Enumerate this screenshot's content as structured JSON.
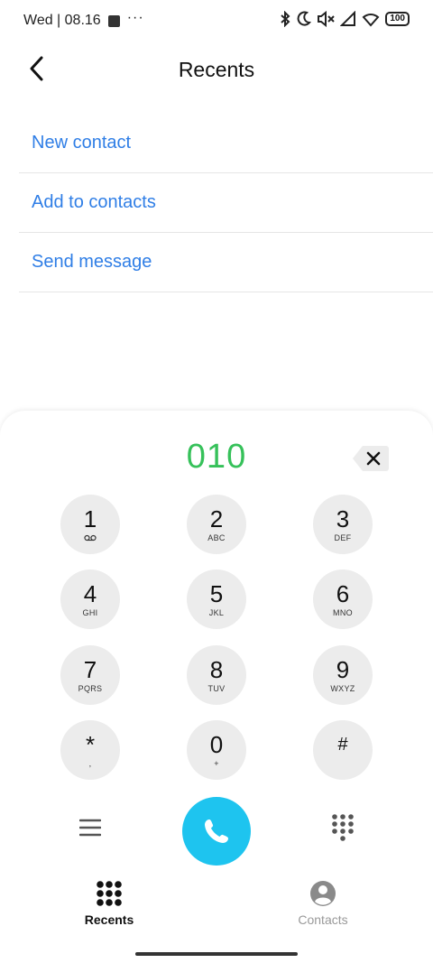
{
  "status_bar": {
    "time": "Wed | 08.16",
    "more": "···",
    "battery": "100"
  },
  "header": {
    "title": "Recents"
  },
  "actions": [
    {
      "label": "New contact"
    },
    {
      "label": "Add to contacts"
    },
    {
      "label": "Send message"
    }
  ],
  "dialer": {
    "number": "010",
    "keys": [
      {
        "digit": "1",
        "sub": ""
      },
      {
        "digit": "2",
        "sub": "ABC"
      },
      {
        "digit": "3",
        "sub": "DEF"
      },
      {
        "digit": "4",
        "sub": "GHI"
      },
      {
        "digit": "5",
        "sub": "JKL"
      },
      {
        "digit": "6",
        "sub": "MNO"
      },
      {
        "digit": "7",
        "sub": "PQRS"
      },
      {
        "digit": "8",
        "sub": "TUV"
      },
      {
        "digit": "9",
        "sub": "WXYZ"
      },
      {
        "digit": "*",
        "sub": ","
      },
      {
        "digit": "0",
        "sub": "+"
      },
      {
        "digit": "#",
        "sub": ""
      }
    ],
    "number_color": "#36c15a",
    "call_color": "#1ec4ef"
  },
  "bottom_nav": {
    "items": [
      {
        "label": "Recents",
        "icon": "dialpad-grid-icon",
        "active": true
      },
      {
        "label": "Contacts",
        "icon": "person-circle-icon",
        "active": false
      }
    ]
  },
  "colors": {
    "link": "#2f7ee6",
    "key_bg": "#ececec"
  }
}
